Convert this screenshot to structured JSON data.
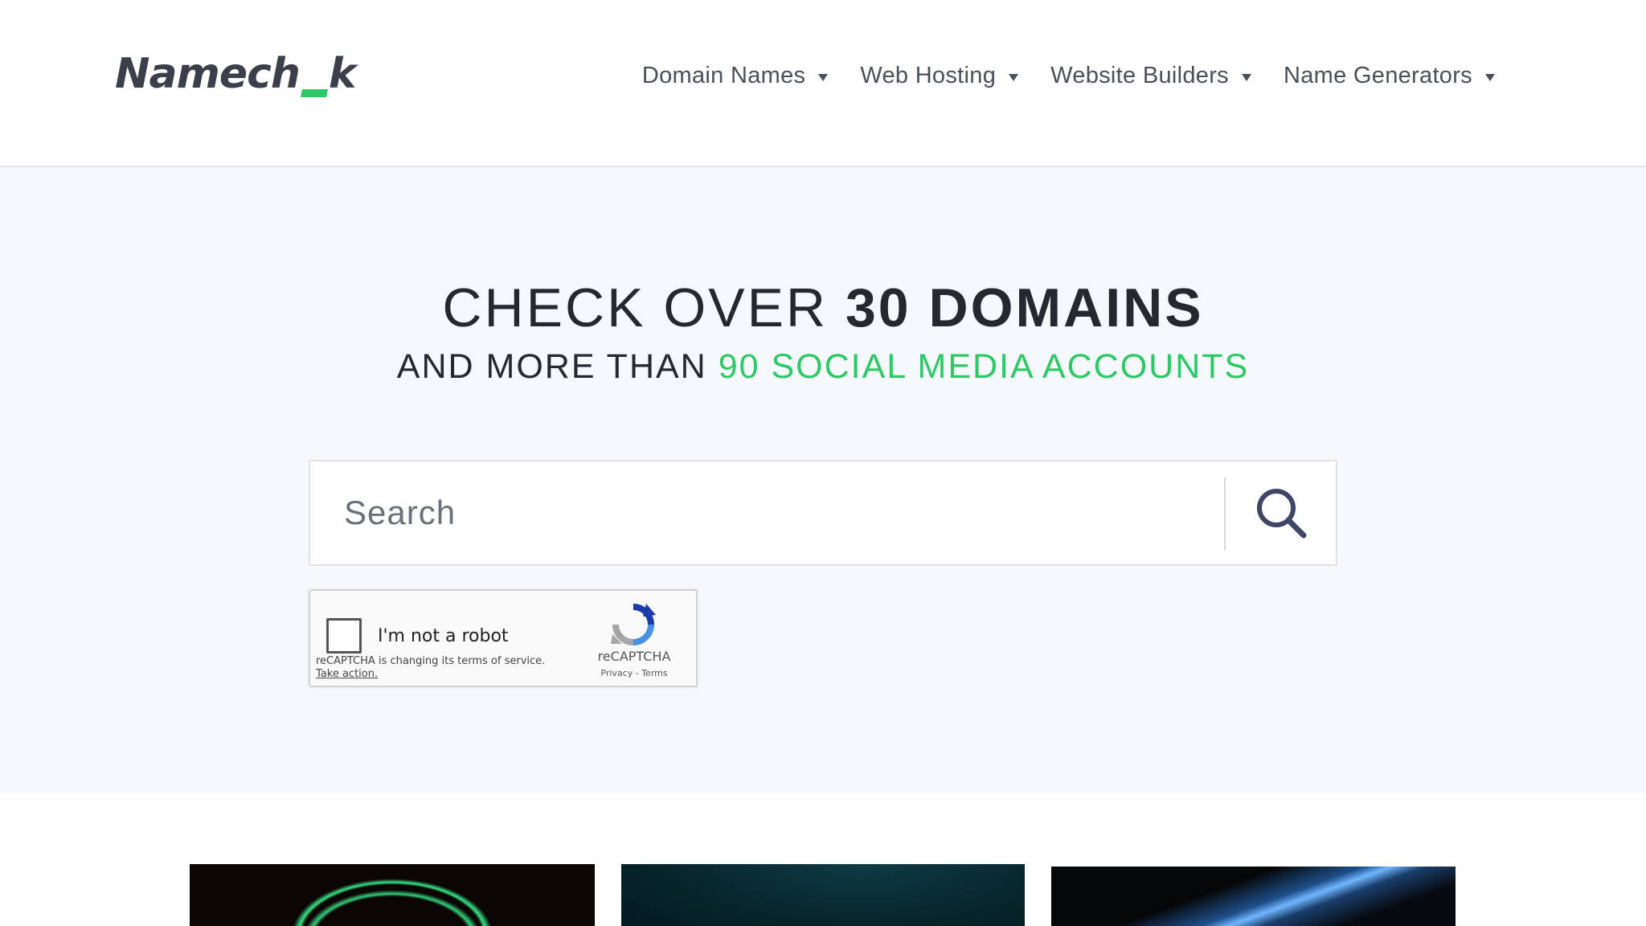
{
  "header": {
    "logo_left": "Namech",
    "logo_right": "k",
    "nav": [
      {
        "label": "Domain Names"
      },
      {
        "label": "Web Hosting"
      },
      {
        "label": "Website Builders"
      },
      {
        "label": "Name Generators"
      }
    ]
  },
  "hero": {
    "headline_light": "CHECK OVER ",
    "headline_bold": "30 DOMAINS",
    "subline_dark": "AND MORE THAN ",
    "subline_green": "90 SOCIAL MEDIA ACCOUNTS"
  },
  "search": {
    "placeholder": "Search",
    "value": ""
  },
  "captcha": {
    "label": "I'm not a robot",
    "notice": "reCAPTCHA is changing its terms of service.",
    "take_action": "Take action.",
    "brand": "reCAPTCHA",
    "links": "Privacy - Terms"
  },
  "colors": {
    "accent_green": "#2ec866",
    "hero_background": "#f5f9fb",
    "text_dark": "#24282f"
  }
}
